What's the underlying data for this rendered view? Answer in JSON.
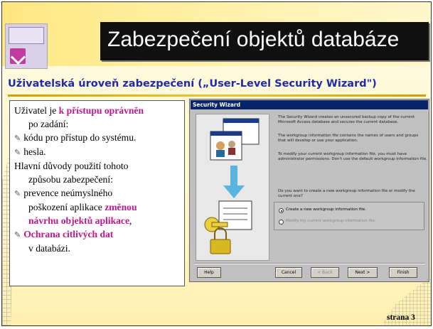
{
  "slide": {
    "title": "Zabezpečení objektů databáze",
    "subtitle": "Uživatelská úroveň zabezpečení („User-Level Security Wizard\")",
    "page_label": "strana 3"
  },
  "textbox": {
    "l1a": "Uživatel je ",
    "l1b": "k přístupu oprávněn",
    "l2": "po zadání:",
    "b1": "kódu pro přístup do systému.",
    "b2": "hesla.",
    "l5": "Hlavní důvody použití tohoto",
    "l6": "způsobu zabezpečení:",
    "b3": "prevence neúmyslného",
    "l8a": "poškození aplikace ",
    "l8b": "změnou",
    "l9a": "návrhu objektů aplikace",
    "l9b": ",",
    "b4": "Ochrana citlivých dat",
    "l11": "v databázi."
  },
  "wizard": {
    "title": "Security Wizard",
    "p1": "The Security Wizard creates an unsecured backup copy of the current Microsoft Access database and secures the current database.",
    "p2": "The workgroup information file contains the names of users and groups that will develop or use your application.",
    "p3": "To modify your current workgroup information file, you must have administrator permissions. Don't use the default workgroup information file.",
    "question": "Do you want to create a new workgroup information file or modify the current one?",
    "option1": "Create a new workgroup information file.",
    "option2": "Modify my current workgroup information file.",
    "btn_help": "Help",
    "btn_cancel": "Cancel",
    "btn_back": "< Back",
    "btn_next": "Next >",
    "btn_finish": "Finish"
  },
  "colors": {
    "title_bg": "#111111",
    "subtitle": "#1f2aa8",
    "accent": "#c0188c",
    "gold_line": "#d2a000",
    "wizard_titlebar": "#0a246a"
  }
}
